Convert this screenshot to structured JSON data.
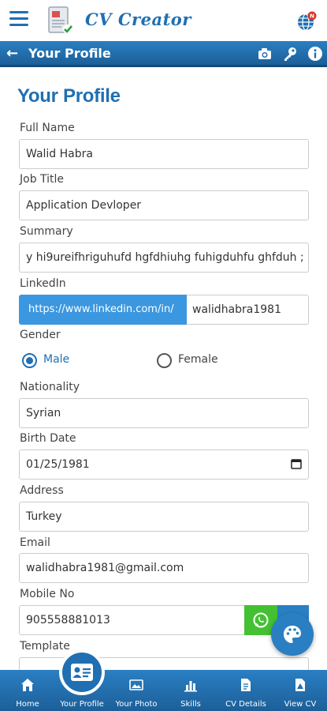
{
  "app": {
    "brand": "CV Creator",
    "globe_badge": "N"
  },
  "titlebar": {
    "title": "Your Profile"
  },
  "form": {
    "page_title": "Your Profile",
    "full_name_label": "Full Name",
    "full_name_value": "Walid Habra",
    "job_title_label": "Job Title",
    "job_title_value": "Application Devloper",
    "summary_label": "Summary",
    "summary_value": "y hi9ureifhriguhufd hgfdhiuhg fuhigduhfu ghfduh ;",
    "linkedin_label": "LinkedIn",
    "linkedin_prefix": "https://www.linkedin.com/in/",
    "linkedin_value": "walidhabra1981",
    "gender_label": "Gender",
    "gender_male": "Male",
    "gender_female": "Female",
    "gender_selected": "Male",
    "nationality_label": "Nationality",
    "nationality_value": "Syrian",
    "birth_date_label": "Birth Date",
    "birth_date_value": "01/25/1981",
    "address_label": "Address",
    "address_value": "Turkey",
    "email_label": "Email",
    "email_value": "walidhabra1981@gmail.com",
    "mobile_label": "Mobile No",
    "mobile_value": "905558881013",
    "template_label": "Template"
  },
  "bottom_nav": {
    "home": "Home",
    "your_profile": "Your Profile",
    "your_photo": "Your Photo",
    "skills": "Skills",
    "cv_details": "CV Details",
    "view_cv": "View CV"
  },
  "colors": {
    "primary": "#1f6fb2",
    "accent": "#3b97e0",
    "whatsapp": "#43c132"
  },
  "icons": [
    "menu-icon",
    "document-logo-icon",
    "globe-icon",
    "back-arrow-icon",
    "camera-icon",
    "key-icon",
    "info-icon",
    "calendar-icon",
    "whatsapp-icon",
    "palette-icon",
    "home-icon",
    "id-card-icon",
    "photo-icon",
    "bar-chart-icon",
    "document-icon",
    "view-document-icon"
  ]
}
